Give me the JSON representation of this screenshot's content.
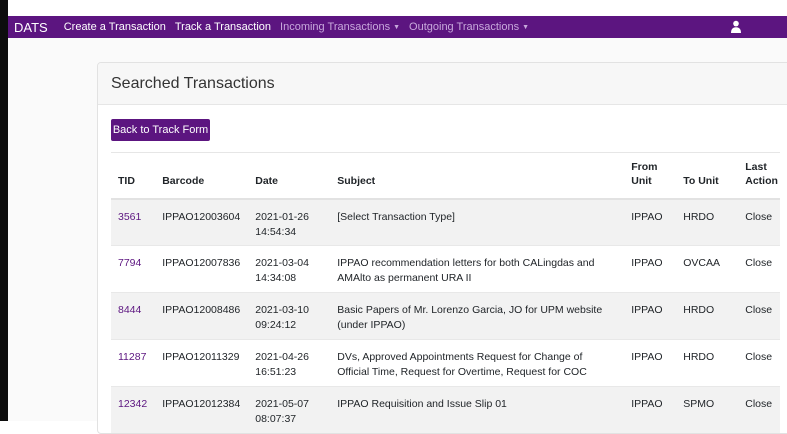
{
  "nav": {
    "brand": "DATS",
    "links": [
      "Create a Transaction",
      "Track a Transaction"
    ],
    "dropdowns": [
      "Incoming Transactions",
      "Outgoing Transactions"
    ],
    "accent": "#5c1580"
  },
  "card": {
    "title": "Searched Transactions",
    "back_button": "Back to Track Form"
  },
  "table": {
    "headers": [
      "TID",
      "Barcode",
      "Date",
      "Subject",
      "From Unit",
      "To Unit",
      "Last Action"
    ],
    "rows": [
      {
        "tid": "3561",
        "barcode": "IPPAO12003604",
        "date": "2021-01-26",
        "time": "14:54:34",
        "subject": "[Select Transaction Type]",
        "from": "IPPAO",
        "to": "HRDO",
        "action": "Close"
      },
      {
        "tid": "7794",
        "barcode": "IPPAO12007836",
        "date": "2021-03-04",
        "time": "14:34:08",
        "subject": "IPPAO recommendation letters for both CALingdas and AMAlto as permanent URA II",
        "from": "IPPAO",
        "to": "OVCAA",
        "action": "Close"
      },
      {
        "tid": "8444",
        "barcode": "IPPAO12008486",
        "date": "2021-03-10",
        "time": "09:24:12",
        "subject": "Basic Papers of Mr. Lorenzo Garcia, JO for UPM website (under IPPAO)",
        "from": "IPPAO",
        "to": "HRDO",
        "action": "Close"
      },
      {
        "tid": "11287",
        "barcode": "IPPAO12011329",
        "date": "2021-04-26",
        "time": "16:51:23",
        "subject": "DVs, Approved Appointments Request for Change of Official Time, Request for Overtime, Request for COC",
        "from": "IPPAO",
        "to": "HRDO",
        "action": "Close"
      },
      {
        "tid": "12342",
        "barcode": "IPPAO12012384",
        "date": "2021-05-07",
        "time": "08:07:37",
        "subject": "IPPAO Requisition and Issue Slip 01",
        "from": "IPPAO",
        "to": "SPMO",
        "action": "Close"
      }
    ]
  }
}
